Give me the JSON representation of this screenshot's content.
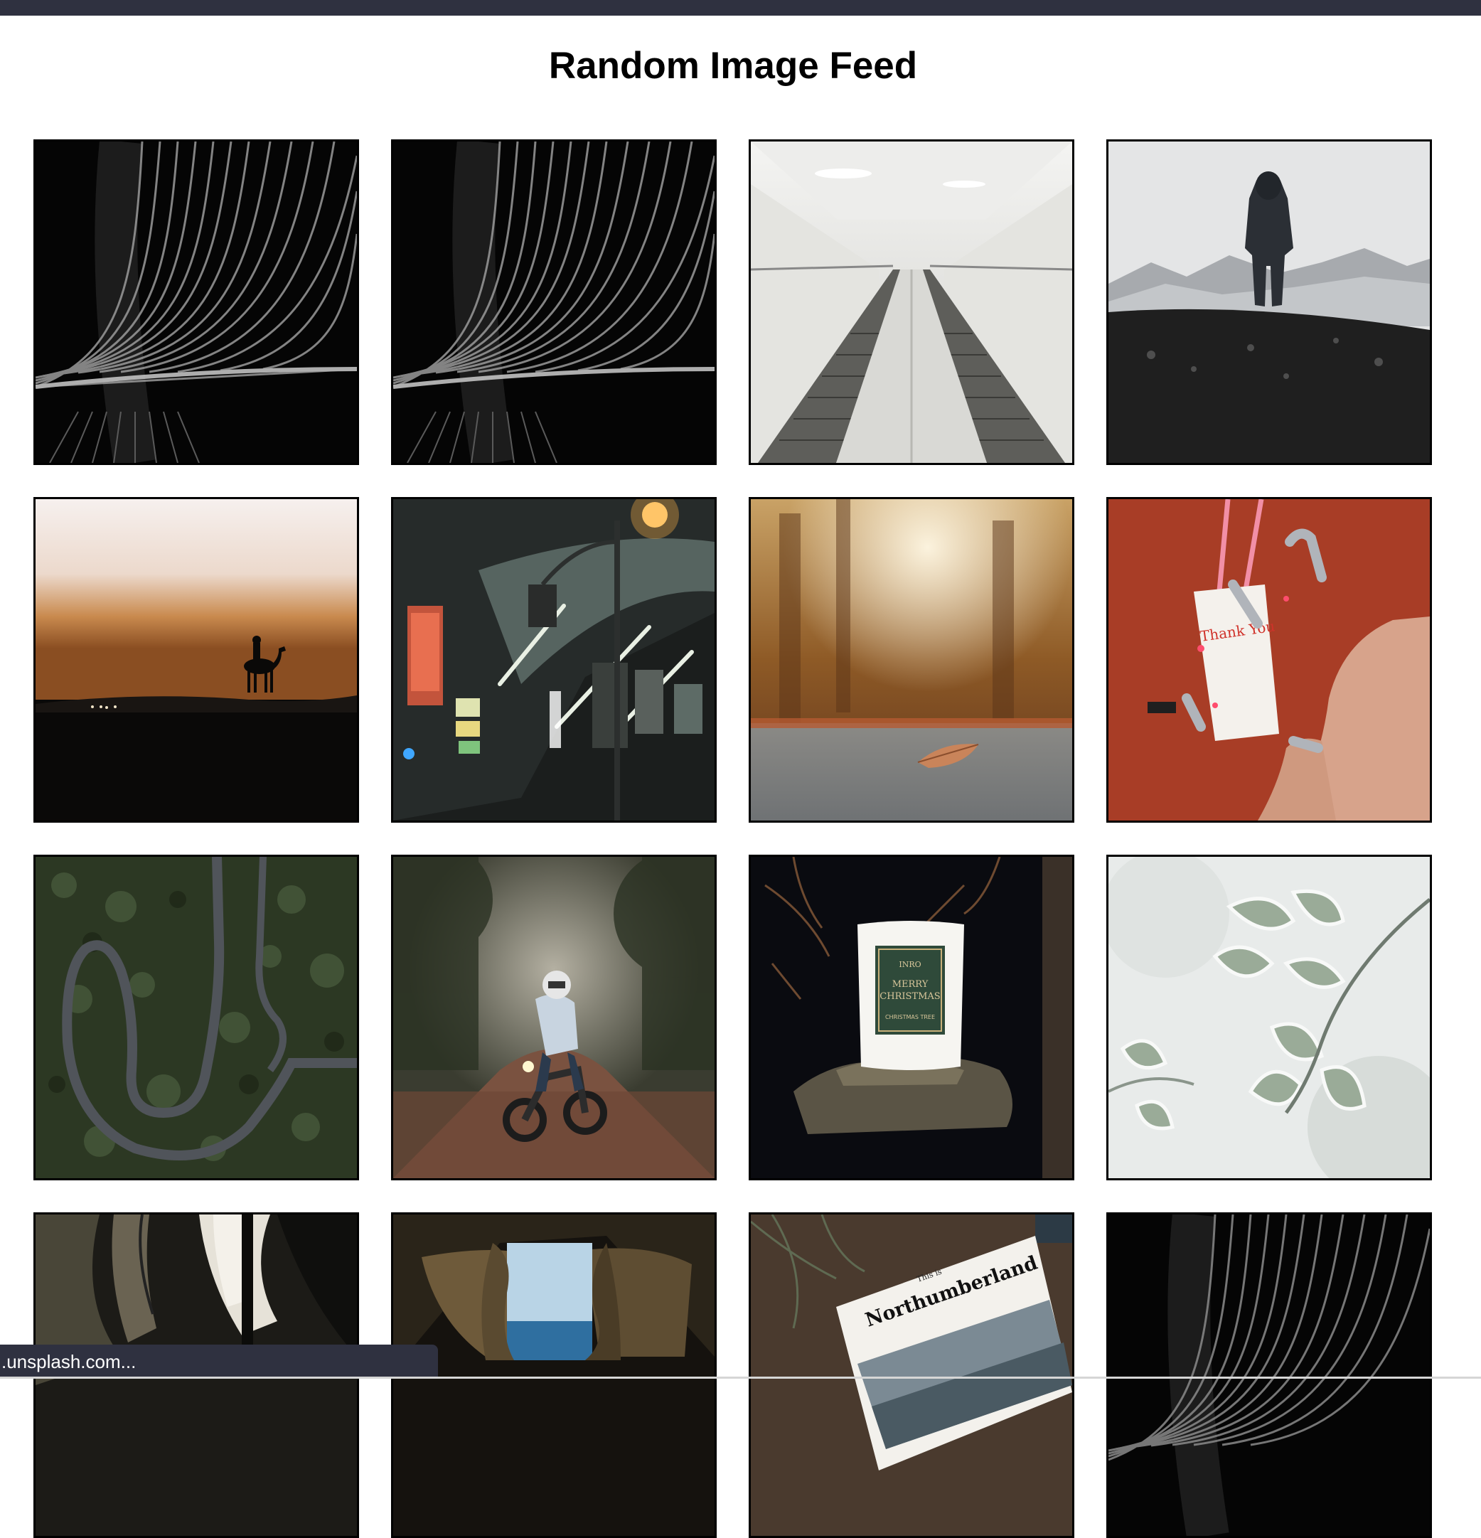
{
  "page": {
    "title": "Random Image Feed"
  },
  "status_bar": {
    "text": ".unsplash.com..."
  },
  "colors": {
    "top_bar": "#2f3140",
    "tile_border": "#000000",
    "status_bar": "#2f3140"
  },
  "images": [
    {
      "subject": "abstract light curves",
      "icon": "abstract-lines-image"
    },
    {
      "subject": "abstract light curves",
      "icon": "abstract-lines-image"
    },
    {
      "subject": "escalator tunnel",
      "icon": "escalator-image"
    },
    {
      "subject": "hiker on mountain",
      "icon": "hiker-image"
    },
    {
      "subject": "camel at sunset",
      "icon": "camel-sunset-image"
    },
    {
      "subject": "night street",
      "icon": "night-street-image"
    },
    {
      "subject": "autumn leaf on road",
      "icon": "autumn-leaf-image"
    },
    {
      "subject": "hands with takeout box",
      "icon": "hands-box-image"
    },
    {
      "subject": "winding road in forest",
      "icon": "winding-road-image"
    },
    {
      "subject": "motorcyclist in forest",
      "icon": "motorcycle-image"
    },
    {
      "subject": "christmas candle",
      "icon": "candle-image",
      "label_lines": [
        "INRO",
        "MERRY",
        "CHRISTMAS",
        "CHRISTMAS TREE"
      ]
    },
    {
      "subject": "frosted leaves",
      "icon": "frost-leaves-image"
    },
    {
      "subject": "leather jacket",
      "icon": "jacket-image"
    },
    {
      "subject": "stone window to sea",
      "icon": "stone-window-image"
    },
    {
      "subject": "northumberland book",
      "icon": "book-image",
      "label_lines": [
        "This is",
        "Northumberland"
      ]
    },
    {
      "subject": "abstract light curves",
      "icon": "abstract-lines-image"
    }
  ]
}
